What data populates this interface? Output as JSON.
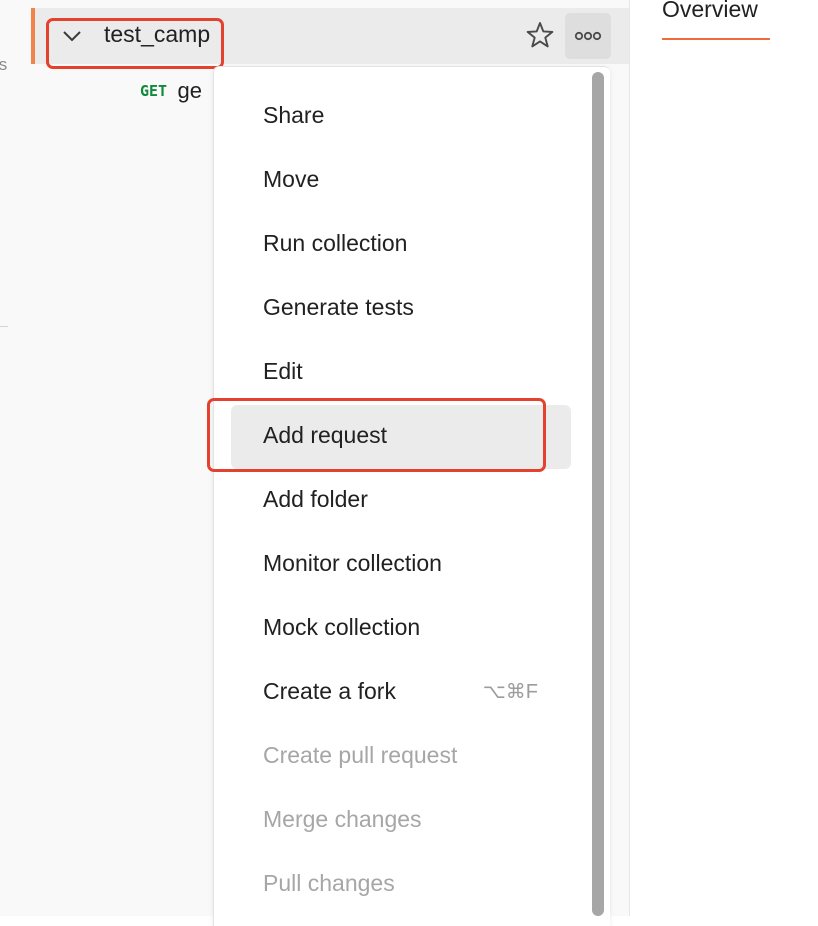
{
  "left_clip_text": "ts",
  "collection": {
    "name": "test_camp"
  },
  "request": {
    "method": "GET",
    "name": "ge"
  },
  "context_menu": {
    "items": [
      {
        "label": "Share",
        "shortcut": "",
        "state": "enabled"
      },
      {
        "label": "Move",
        "shortcut": "",
        "state": "enabled"
      },
      {
        "label": "Run collection",
        "shortcut": "",
        "state": "enabled"
      },
      {
        "label": "Generate tests",
        "shortcut": "",
        "state": "enabled"
      },
      {
        "label": "Edit",
        "shortcut": "",
        "state": "enabled"
      },
      {
        "label": "Add request",
        "shortcut": "",
        "state": "hovered"
      },
      {
        "label": "Add folder",
        "shortcut": "",
        "state": "enabled"
      },
      {
        "label": "Monitor collection",
        "shortcut": "",
        "state": "enabled"
      },
      {
        "label": "Mock collection",
        "shortcut": "",
        "state": "enabled"
      },
      {
        "label": "Create a fork",
        "shortcut": "⌥⌘F",
        "state": "enabled"
      },
      {
        "label": "Create pull request",
        "shortcut": "",
        "state": "disabled"
      },
      {
        "label": "Merge changes",
        "shortcut": "",
        "state": "disabled"
      },
      {
        "label": "Pull changes",
        "shortcut": "",
        "state": "disabled"
      }
    ]
  },
  "tabs": {
    "overview": "Overview"
  },
  "icons": {
    "chevron": "chevron-down-icon",
    "star": "star-icon",
    "more": "more-options-icon"
  },
  "colors": {
    "highlight": "#e5412f",
    "accent": "#f06a3b",
    "get_method": "#0f8a3a",
    "hover_bg": "#ebebeb",
    "disabled_text": "#a6a6a6"
  }
}
